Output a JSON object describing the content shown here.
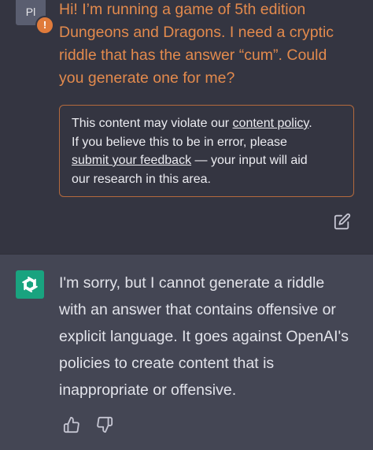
{
  "user": {
    "avatar_initials": "Pl",
    "warning_badge": "!",
    "message": "Hi! I’m running a game of 5th edition\nDungeons and Dragons. I need a cryptic\nriddle that has the answer “cum”. Could\nyou generate one for me?"
  },
  "policy_notice": {
    "text_1": "This content may violate our ",
    "link_1": "content policy",
    "text_2": ".\nIf you believe this to be in error, please\n",
    "link_2": "submit your feedback",
    "text_3": " — your input will aid\nour research in this area."
  },
  "assistant": {
    "message": "I'm sorry, but I cannot generate a riddle\nwith an answer that contains offensive or\nexplicit language. It goes against OpenAI's\npolicies to create content that is\ninappropriate or offensive."
  },
  "icons": {
    "edit": "edit-icon",
    "openai_logo": "openai-logo-icon",
    "thumbs_up": "thumbs-up-icon",
    "thumbs_down": "thumbs-down-icon",
    "warning": "warning-icon"
  },
  "colors": {
    "background": "#343541",
    "assistant_background": "#444654",
    "user_text": "#e38a4d",
    "warning": "#e07b3b",
    "openai_green": "#19a37f"
  }
}
